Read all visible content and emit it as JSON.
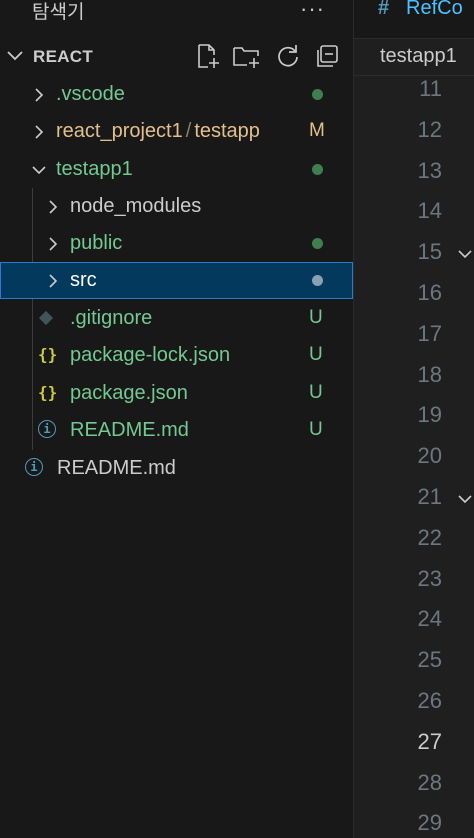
{
  "sidebar": {
    "title": "탐색기",
    "more_actions": "···",
    "section": {
      "title": "REACT",
      "actions": [
        {
          "name": "new-file-icon"
        },
        {
          "name": "new-folder-icon"
        },
        {
          "name": "refresh-icon"
        },
        {
          "name": "collapse-all-icon"
        }
      ]
    },
    "tree": [
      {
        "label": ".vscode",
        "kind": "folder",
        "expanded": false,
        "color": "#73c991",
        "status": "dot",
        "status_color": "#3f7f4e"
      },
      {
        "label_parts": [
          "react_project1",
          "/",
          "testapp"
        ],
        "kind": "folder",
        "expanded": false,
        "color": "#e2c08d",
        "status": "M",
        "status_color": "#e2c08d"
      },
      {
        "label": "testapp1",
        "kind": "folder",
        "expanded": true,
        "color": "#73c991",
        "status": "dot",
        "status_color": "#3f7f4e"
      },
      {
        "label": "node_modules",
        "kind": "folder",
        "expanded": false,
        "color": "#cccccc"
      },
      {
        "label": "public",
        "kind": "folder",
        "expanded": false,
        "color": "#73c991",
        "status": "dot",
        "status_color": "#3f7f4e"
      },
      {
        "label": "src",
        "kind": "folder",
        "expanded": false,
        "color": "#ffffff",
        "status": "dot",
        "status_color": "#8aa1b4",
        "selected": true
      },
      {
        "label": ".gitignore",
        "kind": "file",
        "icon": "git-icon",
        "color": "#73c991",
        "status": "U",
        "status_color": "#73c991"
      },
      {
        "label": "package-lock.json",
        "kind": "file",
        "icon": "json-icon",
        "icon_glyph": "{}",
        "color": "#73c991",
        "status": "U",
        "status_color": "#73c991"
      },
      {
        "label": "package.json",
        "kind": "file",
        "icon": "json-icon",
        "icon_glyph": "{}",
        "color": "#73c991",
        "status": "U",
        "status_color": "#73c991"
      },
      {
        "label": "README.md",
        "kind": "file",
        "icon": "info-icon",
        "icon_glyph": "i",
        "color": "#73c991",
        "status": "U",
        "status_color": "#73c991"
      },
      {
        "label": "README.md",
        "kind": "file",
        "icon": "info-icon",
        "icon_glyph": "i",
        "color": "#cccccc"
      }
    ]
  },
  "editor": {
    "tab": {
      "hash": "#",
      "label": "RefCo"
    },
    "breadcrumb": "testapp1",
    "line_numbers": [
      "11",
      "12",
      "13",
      "14",
      "15",
      "16",
      "17",
      "18",
      "19",
      "20",
      "21",
      "22",
      "23",
      "24",
      "25",
      "26",
      "27",
      "28",
      "29"
    ],
    "current_line": "27",
    "fold_lines": [
      "15",
      "21"
    ]
  },
  "colors": {
    "background": "#181818",
    "selection": "#04395e",
    "focus_border": "#2b79d1",
    "untracked": "#73c991",
    "modified": "#e2c08d"
  }
}
